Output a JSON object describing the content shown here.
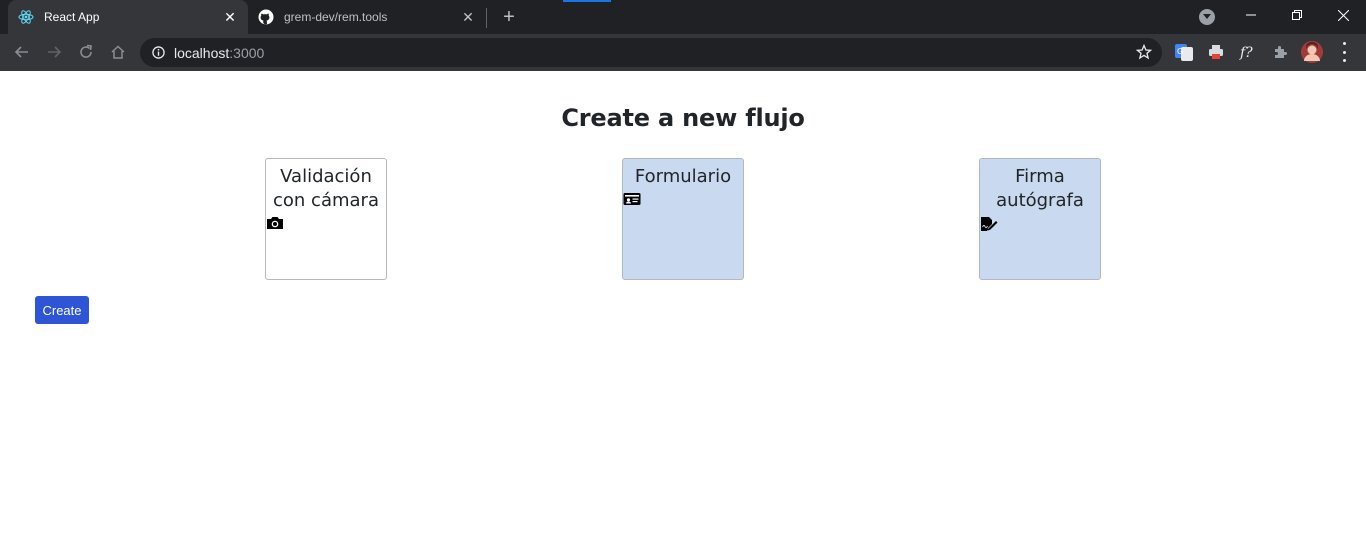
{
  "browser": {
    "tabs": [
      {
        "title": "React App",
        "favicon": "react-logo-icon",
        "active": true
      },
      {
        "title": "grem-dev/rem.tools",
        "favicon": "github-icon",
        "active": false
      }
    ],
    "address_bar": {
      "host": "localhost",
      "port": ":3000"
    },
    "accent_color": "#1a73e8"
  },
  "page": {
    "title": "Create a new flujo",
    "cards": [
      {
        "label": "Validación con cámara",
        "icon": "camera-icon",
        "selected": false
      },
      {
        "label": "Formulario",
        "icon": "id-card-icon",
        "selected": true
      },
      {
        "label": "Firma autógrafa",
        "icon": "signature-icon",
        "selected": true
      }
    ],
    "create_button": "Create",
    "selected_color": "#c9d9ef",
    "button_color": "#2e55d6"
  }
}
